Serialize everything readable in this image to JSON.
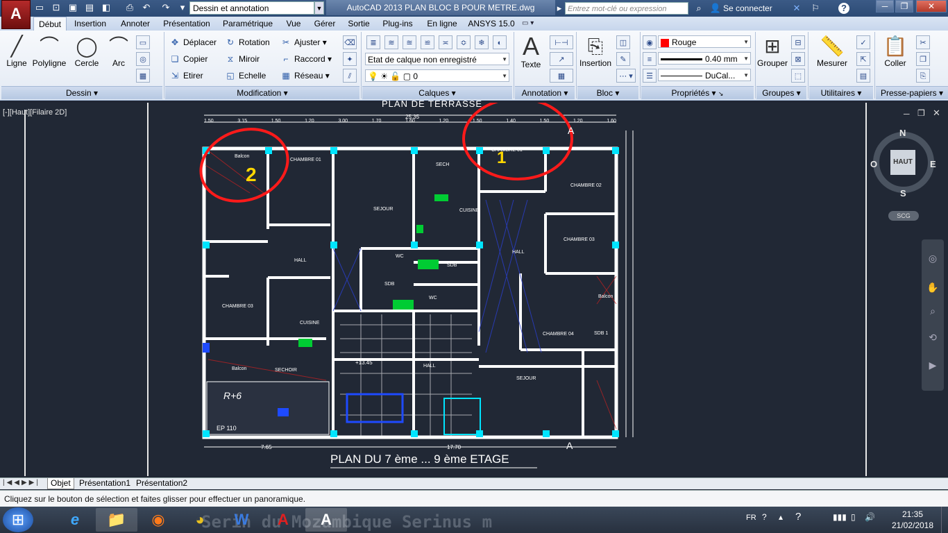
{
  "app": {
    "logo_letter": "A",
    "workspace": "Dessin et annotation",
    "window_title": "AutoCAD 2013    PLAN BLOC B POUR METRE.dwg",
    "search_placeholder": "Entrez mot-clé ou expression",
    "connect_label": "Se connecter",
    "help_label": "?"
  },
  "tabs": [
    "Début",
    "Insertion",
    "Annoter",
    "Présentation",
    "Paramétrique",
    "Vue",
    "Gérer",
    "Sortie",
    "Plug-ins",
    "En ligne",
    "ANSYS 15.0"
  ],
  "ribbon": {
    "dessin": {
      "title": "Dessin",
      "tools": [
        "Ligne",
        "Polyligne",
        "Cercle",
        "Arc"
      ]
    },
    "modification": {
      "title": "Modification",
      "commands": [
        "Déplacer",
        "Rotation",
        "Ajuster",
        "Copier",
        "Miroir",
        "Raccord",
        "Etirer",
        "Echelle",
        "Réseau"
      ]
    },
    "calques": {
      "title": "Calques",
      "current_layer": "Etat de calque non enregistré",
      "layer_value": "0"
    },
    "annotation": {
      "title": "Annotation",
      "texte": "Texte"
    },
    "bloc": {
      "title": "Bloc",
      "insertion": "Insertion"
    },
    "proprietes": {
      "title": "Propriétés",
      "color": "Rouge",
      "color_hex": "#ff0000",
      "lineweight": "0.40 mm",
      "linetype": "DuCal..."
    },
    "groupes": {
      "title": "Groupes",
      "grouper": "Grouper"
    },
    "utilitaires": {
      "title": "Utilitaires",
      "mesurer": "Mesurer"
    },
    "presse_papiers": {
      "title": "Presse-papiers",
      "coller": "Coller"
    }
  },
  "viewport": {
    "label": "[-][Haut][Filaire 2D]",
    "plan_title": "PLAN DU 7 ème ... 9 ème ETAGE",
    "top_title": "PLAN DE TERRASSE",
    "annotation_1": "1",
    "annotation_2": "2",
    "rooms": [
      "CHAMBRE 01",
      "CHAMBRE 02",
      "CHAMBRE 03",
      "CHAMBRE 04",
      "SEJOUR",
      "CUISINE",
      "HALL",
      "SDB",
      "WC",
      "SECH",
      "Balcon",
      "SECHOIR",
      "SDB 1"
    ],
    "dims_top": [
      "1.50",
      "3.15",
      "1.50",
      "1.20",
      "3.00",
      "1.70",
      "1.60",
      "1.20",
      "1.50",
      "1.40",
      "1.50",
      "1.20",
      "1.60"
    ],
    "dim_total_top": "25.35",
    "dims_bottom": [
      "7.65",
      "17.70"
    ],
    "section_mark": "A",
    "misc_labels": [
      "R+6",
      "EP 110",
      "+13.45"
    ]
  },
  "viewcube": {
    "top": "HAUT",
    "n": "N",
    "s": "S",
    "e": "E",
    "o": "O",
    "ucs": "SCG"
  },
  "layout_tabs": [
    "Objet",
    "Présentation1",
    "Présentation2"
  ],
  "command_line": "Cliquez sur le bouton de sélection et faites glisser pour effectuer un panoramique.",
  "taskbar": {
    "language": "FR",
    "time": "21:35",
    "date": "21/02/2018",
    "background_text": "Serin du Mozambique  Serinus m"
  }
}
